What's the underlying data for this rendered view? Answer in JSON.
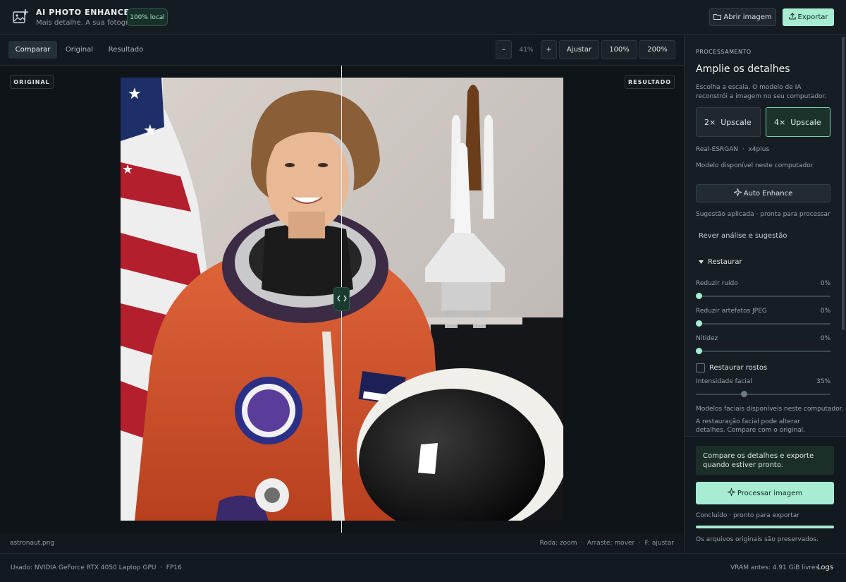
{
  "header": {
    "title": "AI PHOTO ENHANCER",
    "subtitle": "Mais detalhe. A sua fotografia.",
    "badge": "100% local",
    "open_label": "Abrir imagem",
    "export_label": "Exportar",
    "accent_color": "#a7ecd3"
  },
  "toolbar": {
    "tabs": [
      {
        "label": "Comparar",
        "active": true
      },
      {
        "label": "Original",
        "active": false
      },
      {
        "label": "Resultado",
        "active": false
      }
    ],
    "zoom_out": "–",
    "zoom_level": "41%",
    "zoom_in": "+",
    "fit": "Ajustar",
    "zoom_100": "100%",
    "zoom_200": "200%"
  },
  "canvas": {
    "label_left": "ORIGINAL",
    "label_right": "RESULTADO",
    "filename": "astronaut.png",
    "hints": "Roda: zoom  ·  Arraste: mover  ·  F: ajustar"
  },
  "panel": {
    "section_label": "PROCESSAMENTO",
    "title": "Amplie os detalhes",
    "description": "Escolha a escala. O modelo de IA reconstrói a imagem no seu computador.",
    "scale_options": [
      {
        "label": "2×  Upscale",
        "selected": false
      },
      {
        "label": "4×  Upscale",
        "selected": true
      }
    ],
    "model_name": "Real-ESRGAN  ·  x4plus",
    "model_status": "Modelo disponível neste computador",
    "auto_label": "Auto Enhance",
    "auto_status": "Sugestão aplicada · pronta para processar",
    "review_label": "Rever análise e sugestão",
    "restore_label": "Restaurar",
    "sliders": [
      {
        "label": "Reduzir ruído",
        "value_text": "0%",
        "value": 0
      },
      {
        "label": "Reduzir artefatos JPEG",
        "value_text": "0%",
        "value": 0
      },
      {
        "label": "Nitidez",
        "value_text": "0%",
        "value": 0
      }
    ],
    "face_restore_label": "Restaurar rostos",
    "face_intensity": {
      "label": "Intensidade facial",
      "value_text": "35%",
      "value": 35
    },
    "face_models": "Modelos faciais disponíveis neste computador.",
    "face_warning": "A restauração facial pode alterar detalhes. Compare com o original.",
    "hint": "Compare os detalhes e exporte quando estiver pronto.",
    "process_label": "Processar imagem",
    "process_status": "Concluído · pronto para exportar",
    "progress": 100,
    "preserve_note": "Os arquivos originais são preservados."
  },
  "status": {
    "gpu": "Usado: NVIDIA GeForce RTX 4050 Laptop GPU  ·  FP16",
    "vram": "VRAM antes: 4.91 GiB livres",
    "logs": "Logs"
  }
}
